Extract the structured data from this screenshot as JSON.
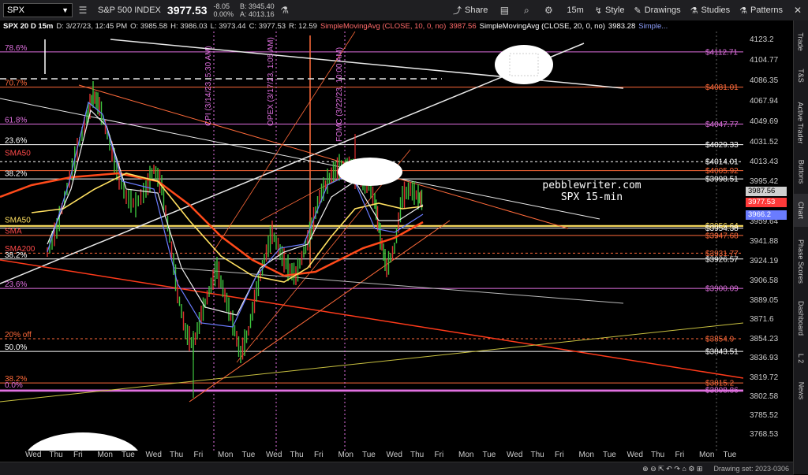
{
  "toolbar": {
    "symbol": "SPX",
    "symbol_name": "S&P 500 INDEX",
    "last_price": "3977.53",
    "change": "-8.05",
    "change_pct": "0.00%",
    "bid": "B: 3945.40",
    "ask": "A: 4013.16",
    "share_label": "Share",
    "timeframe_label": "15m",
    "style_label": "Style",
    "drawings_label": "Drawings",
    "studies_label": "Studies",
    "patterns_label": "Patterns"
  },
  "legend": {
    "symbol": "SPX 20 D 15m",
    "date": "D: 3/27/23, 12:45 PM",
    "open": "O: 3985.58",
    "high": "H: 3986.03",
    "low": "L: 3973.44",
    "close": "C: 3977.53",
    "range": "R: 12.59",
    "sma10_label": "SimpleMovingAvg (CLOSE, 10, 0, no)",
    "sma10_value": "3987.56",
    "sma20_label": "SimpleMovingAvg (CLOSE, 20, 0, no)",
    "sma20_value": "3983.28",
    "more": "Simple..."
  },
  "right_tabs": [
    "Trade",
    "T&S",
    "Active Trader",
    "Buttons",
    "Chart",
    "Phase Scores",
    "Dashboard",
    "L 2",
    "News"
  ],
  "y_ticks": [
    "4123.2",
    "4104.77",
    "4086.35",
    "4067.94",
    "4049.69",
    "4031.52",
    "4013.43",
    "3995.42",
    "3977.53",
    "3959.64",
    "3941.88",
    "3924.19",
    "3906.58",
    "3889.05",
    "3871.6",
    "3854.23",
    "3836.93",
    "3819.72",
    "3802.58",
    "3785.52",
    "3768.53"
  ],
  "x_ticks": [
    "Wed",
    "Thu",
    "Fri",
    "Mon",
    "Tue",
    "Wed",
    "Thu",
    "Fri",
    "Mon",
    "Tue",
    "Wed",
    "Thu",
    "Fri",
    "Mon",
    "Tue",
    "Wed",
    "Thu",
    "Fri",
    "Mon",
    "Tue",
    "Wed",
    "Thu",
    "Fri",
    "Mon",
    "Tue",
    "Wed",
    "Thu",
    "Fri",
    "Mon",
    "Tue"
  ],
  "level_labels": [
    {
      "text": "$4112.71",
      "color": "#e070e0"
    },
    {
      "text": "$4081.01",
      "color": "#ff6a3a"
    },
    {
      "text": "$4047.77",
      "color": "#e070e0"
    },
    {
      "text": "$4029.33",
      "color": "#ffffff"
    },
    {
      "text": "$4014.01",
      "color": "#ffffff"
    },
    {
      "text": "$4005.92",
      "color": "#ff6a3a"
    },
    {
      "text": "$3998.51",
      "color": "#ffffff"
    },
    {
      "text": "$3956.64",
      "color": "#ffe060"
    },
    {
      "text": "$3954.38",
      "color": "#ffffff"
    },
    {
      "text": "$3947.68",
      "color": "#ff6a3a"
    },
    {
      "text": "$3931.77",
      "color": "#ff6a3a"
    },
    {
      "text": "$3926.57",
      "color": "#ffffff"
    },
    {
      "text": "$3900.09",
      "color": "#e070e0"
    },
    {
      "text": "$3854.9",
      "color": "#ff6a3a"
    },
    {
      "text": "$3843.51",
      "color": "#ffffff"
    },
    {
      "text": "$3815.2",
      "color": "#ff6a3a"
    },
    {
      "text": "$3808.86",
      "color": "#e070e0"
    }
  ],
  "fib_labels": [
    {
      "text": "78.6%",
      "color": "#e070e0"
    },
    {
      "text": "70.7%",
      "color": "#ff6a3a"
    },
    {
      "text": "61.8%",
      "color": "#e070e0"
    },
    {
      "text": "23.6%",
      "color": "#ffffff"
    },
    {
      "text": "SMA50",
      "color": "#ff4a4a"
    },
    {
      "text": "38.2%",
      "color": "#ffffff"
    },
    {
      "text": "SMA50",
      "color": "#ffe060"
    },
    {
      "text": "SMA",
      "color": "#ff4a4a"
    },
    {
      "text": "SMA200",
      "color": "#ff4a4a"
    },
    {
      "text": "38.2%",
      "color": "#ffffff"
    },
    {
      "text": "23.6%",
      "color": "#e070e0"
    },
    {
      "text": "20% off",
      "color": "#ff6a3a"
    },
    {
      "text": "50.0%",
      "color": "#ffffff"
    },
    {
      "text": "38.2%",
      "color": "#ff6a3a"
    },
    {
      "text": "0.0%",
      "color": "#e070e0"
    }
  ],
  "events": [
    {
      "text": "CPI (3/14/23, 5:30 AM)"
    },
    {
      "text": "OPEX (3/17/23, 1:05 AM)"
    },
    {
      "text": "FOMC (3/22/23, 10:00 AM)"
    }
  ],
  "price_tags": [
    {
      "text": "3987.56",
      "bg": "#d0d0d0",
      "fg": "#000000"
    },
    {
      "text": "3977.53",
      "bg": "#ff3a3a",
      "fg": "#ffffff"
    },
    {
      "text": "3966.2",
      "bg": "#6a7cff",
      "fg": "#ffffff"
    }
  ],
  "watermark": {
    "line1": "pebblewriter.com",
    "line2": "SPX 15-min"
  },
  "status": {
    "drawing_set": "Drawing set: 2023-0306"
  },
  "colors": {
    "background": "#000000",
    "sma10": "#6a7cff",
    "sma20": "#f0f0f0",
    "sma50": "#ffe060",
    "sma200": "#ff4a1a",
    "fib_magenta": "#e070e0",
    "fib_orange": "#ff6a3a"
  }
}
